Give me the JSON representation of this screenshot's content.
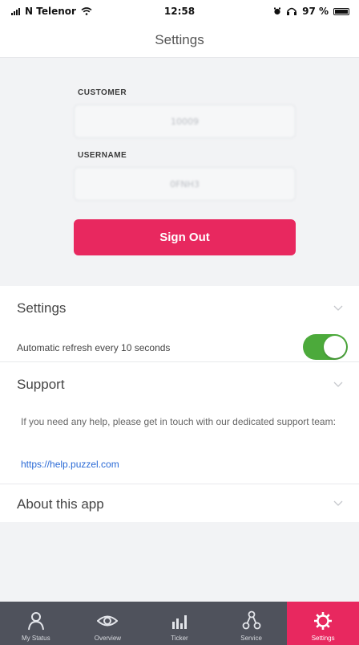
{
  "status_bar": {
    "carrier": "N Telenor",
    "time": "12:58",
    "battery": "97 %"
  },
  "nav": {
    "title": "Settings"
  },
  "account": {
    "customer_label": "CUSTOMER",
    "customer_value": "10009",
    "username_label": "USERNAME",
    "username_value": "0FNH3",
    "sign_out_label": "Sign Out"
  },
  "sections": {
    "settings": {
      "title": "Settings",
      "auto_refresh_label": "Automatic refresh every 10 seconds",
      "auto_refresh_enabled": true
    },
    "support": {
      "title": "Support",
      "text": "If you need any help, please get in touch with our dedicated support team:",
      "link": "https://help.puzzel.com"
    },
    "about": {
      "title": "About this app"
    }
  },
  "tabs": [
    {
      "label": "My Status",
      "icon": "person-icon",
      "active": false
    },
    {
      "label": "Overview",
      "icon": "eye-icon",
      "active": false
    },
    {
      "label": "Ticker",
      "icon": "bar-chart-icon",
      "active": false
    },
    {
      "label": "Service",
      "icon": "service-nodes-icon",
      "active": false
    },
    {
      "label": "Settings",
      "icon": "gear-icon",
      "active": true
    }
  ],
  "colors": {
    "accent": "#e8285f",
    "toggle_on": "#4caa3b",
    "tab_bar": "#4f525c",
    "link": "#2a6ad6"
  }
}
